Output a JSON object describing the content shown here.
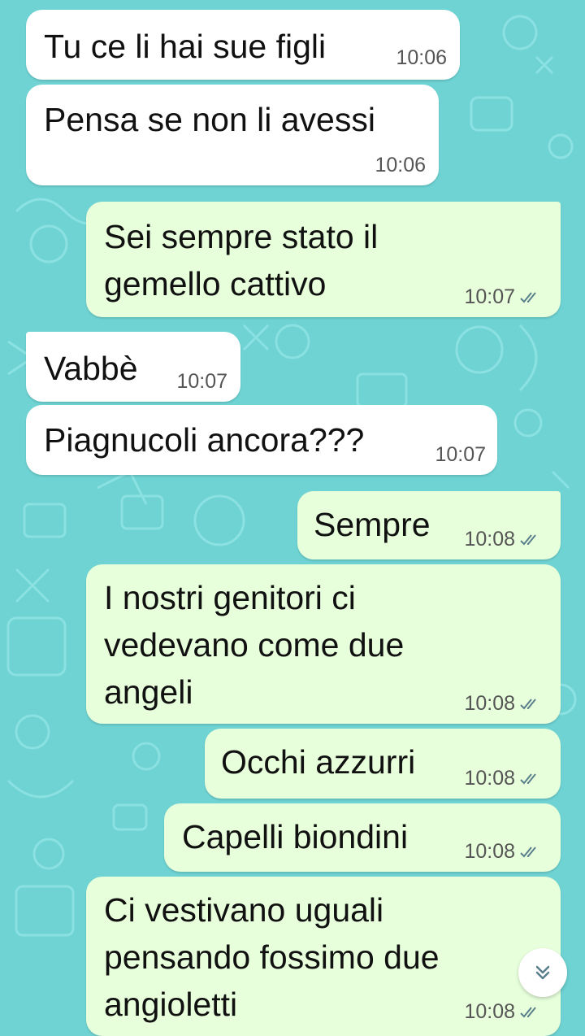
{
  "messages": [
    {
      "text": "Tu ce li hai sue figli",
      "time": "10:06"
    },
    {
      "text": "Pensa se non li avessi",
      "time": "10:06"
    },
    {
      "text": "Sei sempre stato il\ngemello cattivo",
      "time": "10:07"
    },
    {
      "text": "Vabbè",
      "time": "10:07"
    },
    {
      "text": "Piagnucoli ancora???",
      "time": "10:07"
    },
    {
      "text": "Sempre",
      "time": "10:08"
    },
    {
      "text": "I nostri genitori ci\nvedevano come due\nangeli",
      "time": "10:08"
    },
    {
      "text": "Occhi azzurri",
      "time": "10:08"
    },
    {
      "text": "Capelli biondini",
      "time": "10:08"
    },
    {
      "text": "Ci vestivano uguali\npensando fossimo due\nangioletti",
      "time": "10:08"
    }
  ],
  "icons": {
    "read_receipt": "double-check-icon",
    "scroll_down": "double-chevron-down-icon"
  },
  "colors": {
    "wallpaper": "#6fd3d3",
    "incoming": "#ffffff",
    "outgoing": "#e7ffdb",
    "tick": "#5a7f8c"
  }
}
